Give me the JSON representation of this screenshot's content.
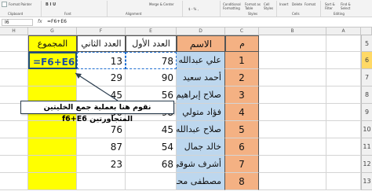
{
  "ribbon": {
    "format_painter": "Format Painter",
    "clipboard": "Clipboard",
    "font": "Font",
    "alignment": "Alignment",
    "merge_center": "Merge & Center",
    "number_format": "$ - % ,",
    "conditional_formatting": "Conditional Formatting",
    "format_as_table": "Format as Table",
    "cell_styles": "Cell Styles",
    "styles": "Styles",
    "insert": "Insert",
    "delete": "Delete",
    "format": "Format",
    "cells": "Cells",
    "sort_filter": "Sort & Filter",
    "find_select": "Find & Select",
    "editing": "Editing"
  },
  "formula_bar": {
    "name_box": "I6",
    "fx": "fx",
    "formula": "=F6+E6"
  },
  "columns": [
    "H",
    "G",
    "F",
    "E",
    "D",
    "C",
    "B",
    "A"
  ],
  "headers": {
    "total": "المجموع",
    "second": "العدد الثاني",
    "first": "العدد الأول",
    "name": "الاسم",
    "index": "م"
  },
  "rows": [
    {
      "row": "5",
      "index": "",
      "name": "",
      "first": "",
      "second": "",
      "total": ""
    },
    {
      "row": "6",
      "index": "1",
      "name": "علي عبدالله",
      "first": "78",
      "second": "13",
      "total": "=F6+E6"
    },
    {
      "row": "7",
      "index": "2",
      "name": "أحمد سعيد",
      "first": "90",
      "second": "29",
      "total": ""
    },
    {
      "row": "8",
      "index": "3",
      "name": "صلاح إبراهيم",
      "first": "56",
      "second": "45",
      "total": ""
    },
    {
      "row": "9",
      "index": "4",
      "name": "فؤاد متولي",
      "first": "98",
      "second": "50",
      "total": ""
    },
    {
      "row": "10",
      "index": "5",
      "name": "صلاح عبدالله",
      "first": "45",
      "second": "76",
      "total": ""
    },
    {
      "row": "11",
      "index": "6",
      "name": "خالد جمال",
      "first": "54",
      "second": "87",
      "total": ""
    },
    {
      "row": "12",
      "index": "7",
      "name": "أشرف شوقي",
      "first": "68",
      "second": "23",
      "total": ""
    },
    {
      "row": "13",
      "index": "8",
      "name": "مصطفى محمد",
      "first": "",
      "second": "",
      "total": ""
    }
  ],
  "callout": "نقوم هنا بعملية جمع الخليتين المتجاورتين f6+E6",
  "colors": {
    "header_fill": "#f4b183",
    "name_fill": "#bdd7ee",
    "total_fill": "#ffff00",
    "index_fill": "#f4b183"
  }
}
